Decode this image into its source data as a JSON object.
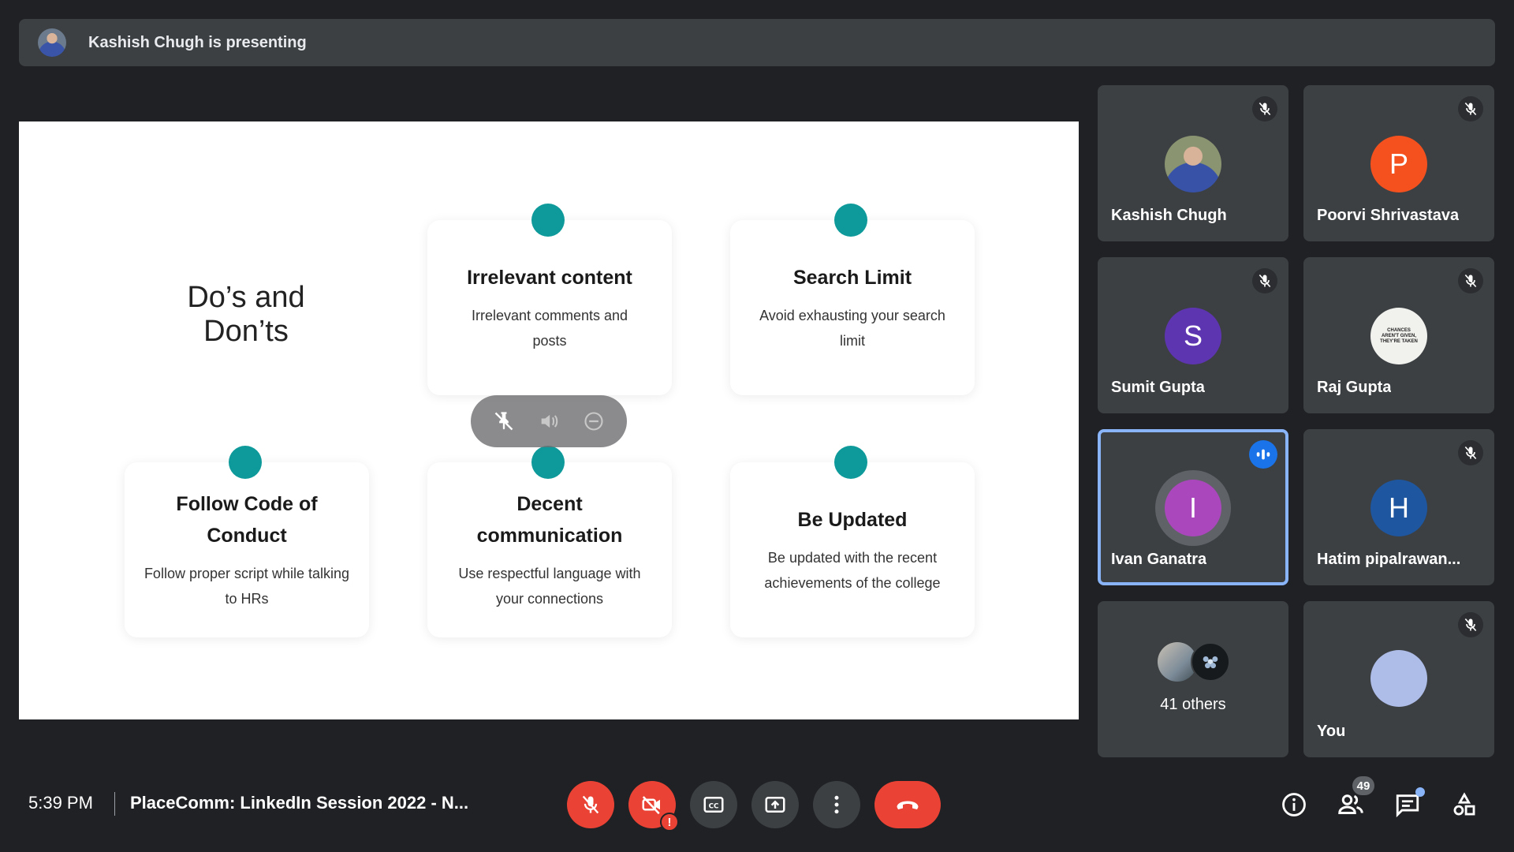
{
  "presenting_bar": {
    "text": "Kashish Chugh is presenting",
    "avatar_icon": "user-photo"
  },
  "slide": {
    "title": "Do’s and Don’ts",
    "accent_color": "#0e9a9a",
    "cards": [
      {
        "title": "Irrelevant content",
        "desc": "Irrelevant comments and posts"
      },
      {
        "title": "Search Limit",
        "desc": "Avoid exhausting your search limit"
      },
      {
        "title": "Follow Code of Conduct",
        "desc": "Follow proper script while talking to HRs"
      },
      {
        "title": "Decent communication",
        "desc": "Use respectful language with your connections"
      },
      {
        "title": "Be Updated",
        "desc": "Be updated with the recent achievements of the college"
      }
    ]
  },
  "pin_overlay": {
    "icons": [
      "unpin-icon",
      "volume-icon",
      "remove-icon"
    ]
  },
  "participants": [
    {
      "name": "Kashish Chugh",
      "initial": "",
      "avatar_color": "#6b7a8c",
      "muted": true,
      "speaking": false
    },
    {
      "name": "Poorvi Shrivastava",
      "initial": "P",
      "avatar_color": "#f4511e",
      "muted": true,
      "speaking": false
    },
    {
      "name": "Sumit Gupta",
      "initial": "S",
      "avatar_color": "#5e35b1",
      "muted": true,
      "speaking": false
    },
    {
      "name": "Raj Gupta",
      "initial": "",
      "avatar_color": "#f1f1ee",
      "muted": true,
      "speaking": false,
      "avatar_text": "CHANCES AREN'T GIVEN, THEY'RE TAKEN"
    },
    {
      "name": "Ivan Ganatra",
      "initial": "I",
      "avatar_color": "#ab47bc",
      "muted": false,
      "speaking": true
    },
    {
      "name": "Hatim pipalrawan...",
      "initial": "H",
      "avatar_color": "#1e56a0",
      "muted": true,
      "speaking": false
    },
    {
      "name": "41 others",
      "initial": "",
      "avatar_color": "",
      "muted": false,
      "speaking": false
    },
    {
      "name": "You",
      "initial": "",
      "avatar_color": "#aebce8",
      "muted": true,
      "speaking": false
    }
  ],
  "bottom_bar": {
    "time": "5:39 PM",
    "meeting_title": "PlaceComm: LinkedIn Session 2022 - N...",
    "alert_mark": "!",
    "people_count": "49"
  },
  "colors": {
    "background": "#202124",
    "tile": "#3c4043",
    "danger": "#ea4335",
    "speaking": "#1a73e8",
    "active_border": "#8ab4f8"
  }
}
